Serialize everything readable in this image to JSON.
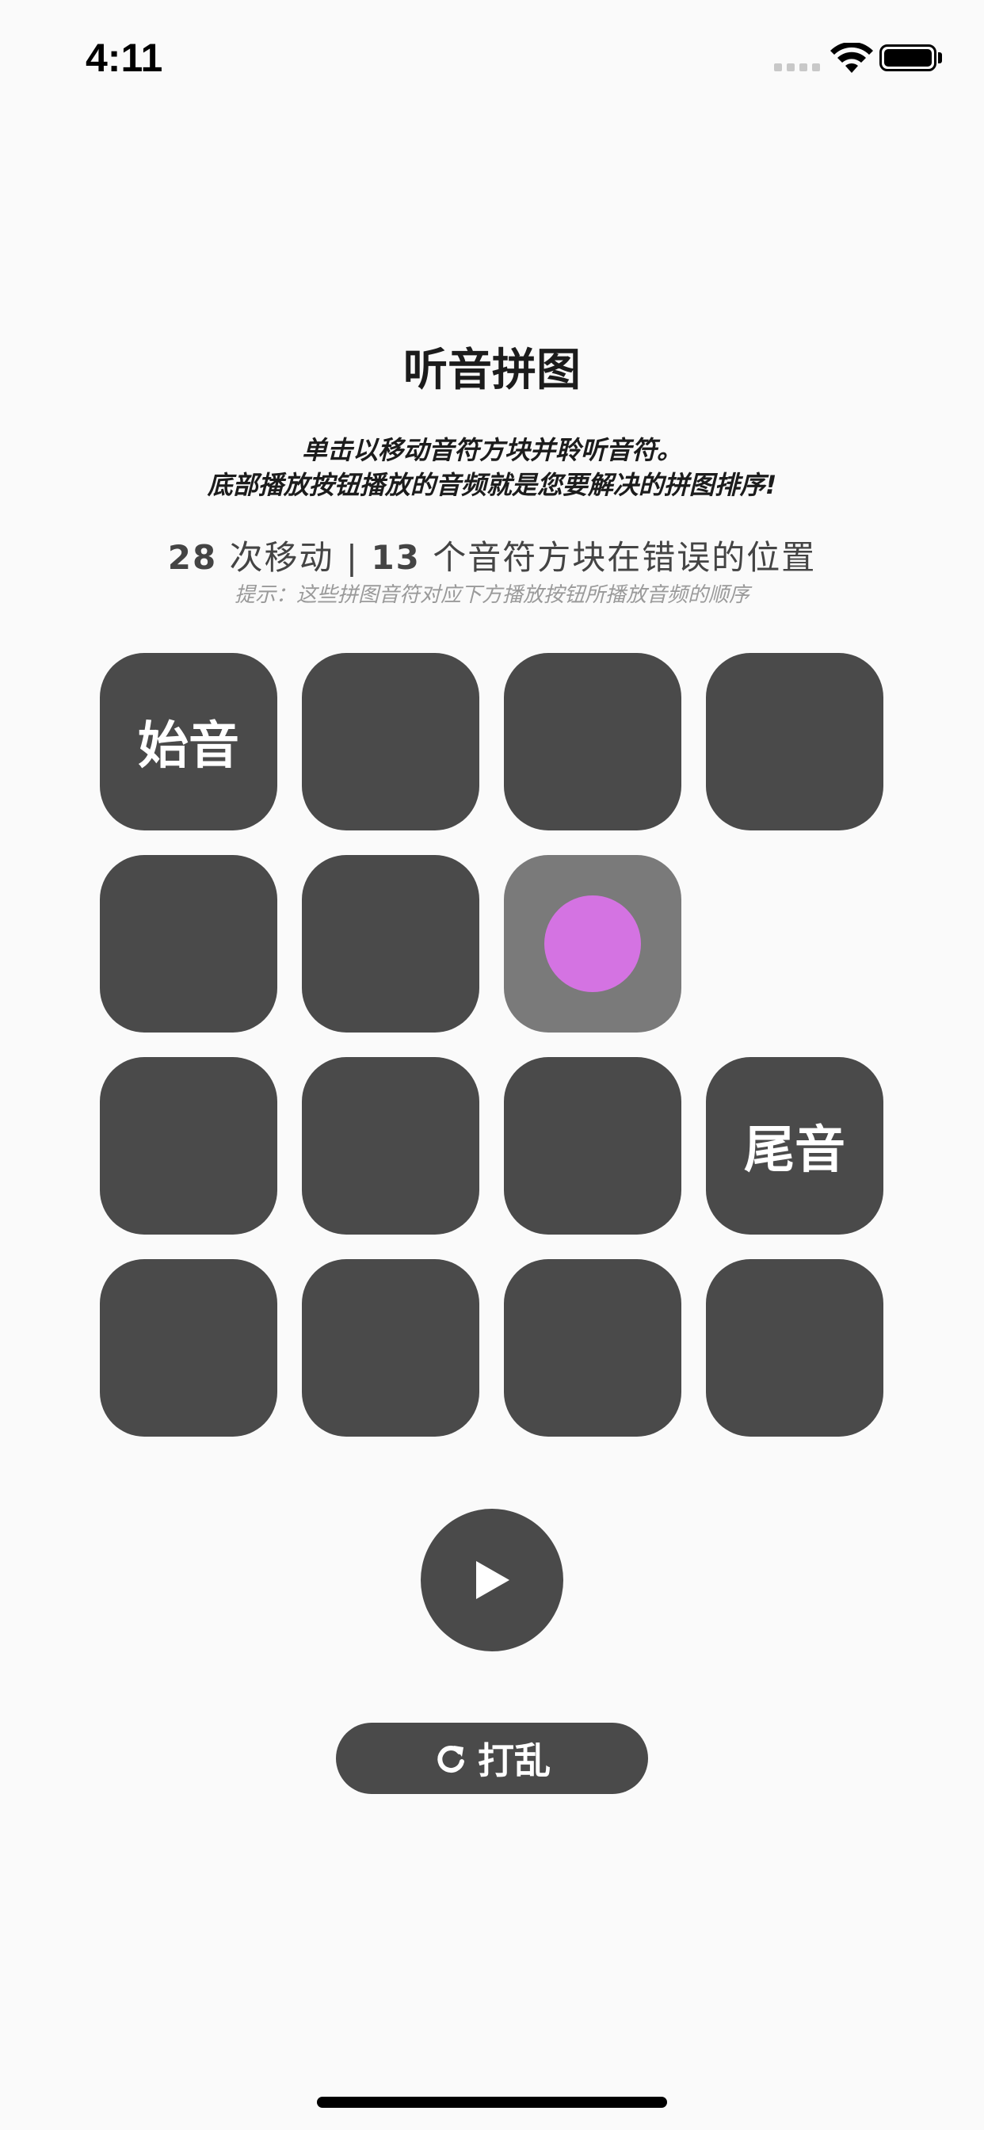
{
  "status_bar": {
    "time": "4:11"
  },
  "header": {
    "title": "听音拼图",
    "description_line1": "单击以移动音符方块并聆听音符。",
    "description_line2": "底部播放按钮播放的音频就是您要解决的拼图排序!"
  },
  "stats": {
    "moves": "28",
    "moves_label": "次移动",
    "separator": "|",
    "wrong_count": "13",
    "wrong_label": "个音符方块在错误的位置",
    "hint": "提示：这些拼图音符对应下方播放按钮所播放音频的顺序"
  },
  "grid": {
    "start_label": "始音",
    "end_label": "尾音",
    "tiles": [
      {
        "type": "label",
        "label": "始音"
      },
      {
        "type": "blank"
      },
      {
        "type": "blank"
      },
      {
        "type": "blank"
      },
      {
        "type": "blank"
      },
      {
        "type": "blank"
      },
      {
        "type": "selected",
        "dot_color": "#d473e2"
      },
      {
        "type": "empty"
      },
      {
        "type": "blank"
      },
      {
        "type": "blank"
      },
      {
        "type": "blank"
      },
      {
        "type": "label",
        "label": "尾音"
      },
      {
        "type": "blank"
      },
      {
        "type": "blank"
      },
      {
        "type": "blank"
      },
      {
        "type": "blank"
      }
    ]
  },
  "controls": {
    "play_icon": "play-icon",
    "shuffle_icon": "refresh-icon",
    "shuffle_label": "打乱"
  },
  "colors": {
    "tile": "#4a4a4a",
    "tile_selected": "#7a7a7a",
    "accent_dot": "#d473e2",
    "background": "#fafafa"
  }
}
